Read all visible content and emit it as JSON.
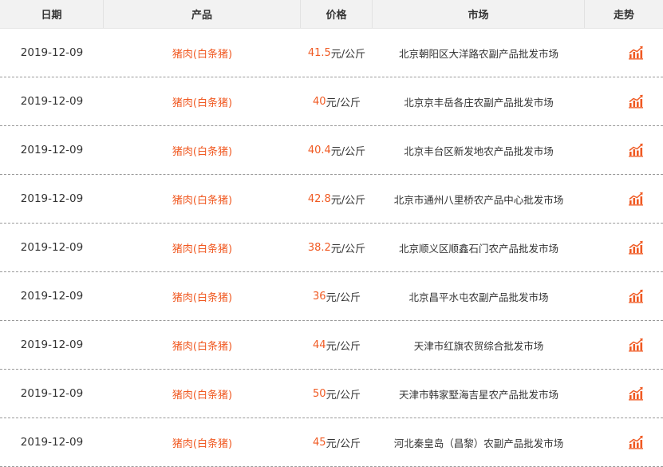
{
  "header": {
    "date": "日期",
    "product": "产品",
    "price": "价格",
    "market": "市场",
    "trend": "走势"
  },
  "colors": {
    "accent": "#f05a23",
    "header_bg": "#f2f2f2",
    "text": "#333333"
  },
  "trend_icon": "trend-chart-icon",
  "rows": [
    {
      "date": "2019-12-09",
      "product": "猪肉(白条猪)",
      "price": "41.5",
      "unit": "元/公斤",
      "market": "北京朝阳区大洋路农副产品批发市场"
    },
    {
      "date": "2019-12-09",
      "product": "猪肉(白条猪)",
      "price": "40",
      "unit": "元/公斤",
      "market": "北京京丰岳各庄农副产品批发市场"
    },
    {
      "date": "2019-12-09",
      "product": "猪肉(白条猪)",
      "price": "40.4",
      "unit": "元/公斤",
      "market": "北京丰台区新发地农产品批发市场"
    },
    {
      "date": "2019-12-09",
      "product": "猪肉(白条猪)",
      "price": "42.8",
      "unit": "元/公斤",
      "market": "北京市通州八里桥农产品中心批发市场"
    },
    {
      "date": "2019-12-09",
      "product": "猪肉(白条猪)",
      "price": "38.2",
      "unit": "元/公斤",
      "market": "北京顺义区顺鑫石门农产品批发市场"
    },
    {
      "date": "2019-12-09",
      "product": "猪肉(白条猪)",
      "price": "36",
      "unit": "元/公斤",
      "market": "北京昌平水屯农副产品批发市场"
    },
    {
      "date": "2019-12-09",
      "product": "猪肉(白条猪)",
      "price": "44",
      "unit": "元/公斤",
      "market": "天津市红旗农贸综合批发市场"
    },
    {
      "date": "2019-12-09",
      "product": "猪肉(白条猪)",
      "price": "50",
      "unit": "元/公斤",
      "market": "天津市韩家墅海吉星农产品批发市场"
    },
    {
      "date": "2019-12-09",
      "product": "猪肉(白条猪)",
      "price": "45",
      "unit": "元/公斤",
      "market": "河北秦皇岛（昌黎）农副产品批发市场"
    }
  ]
}
